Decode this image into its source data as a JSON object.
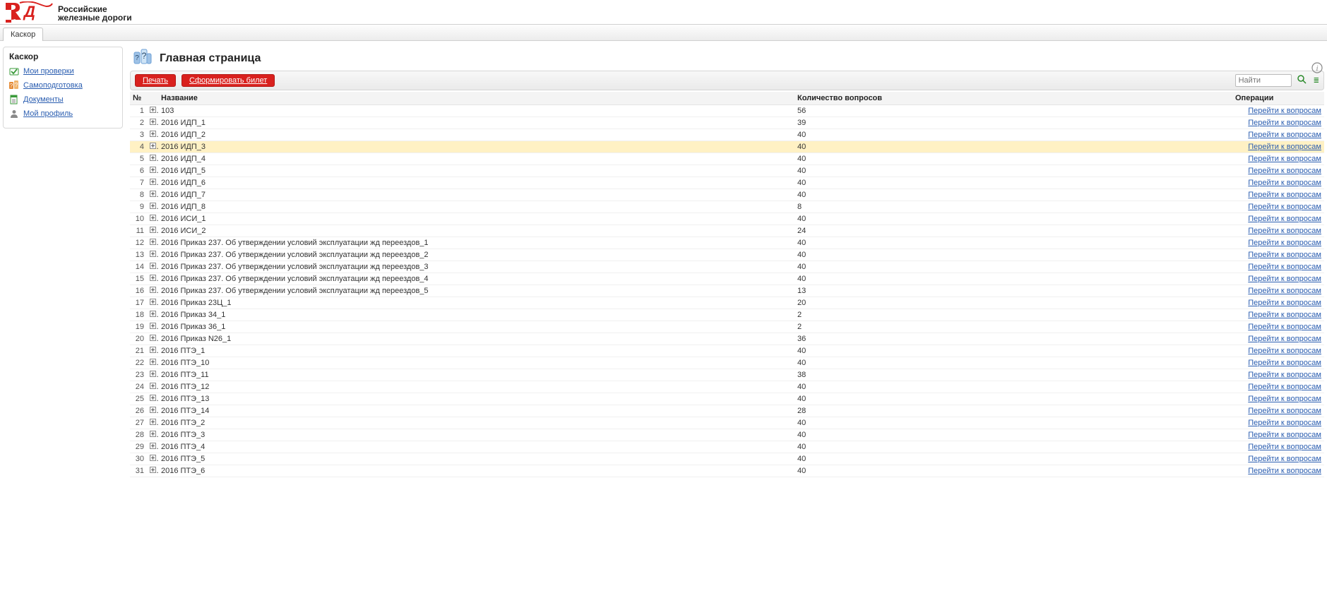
{
  "brand": {
    "line1": "Российские",
    "line2": "железные дороги"
  },
  "tabs": [
    {
      "label": "Каскор",
      "active": true
    }
  ],
  "sidebar": {
    "title": "Каскор",
    "items": [
      {
        "label": "Мои проверки",
        "id": "my-checks",
        "icon": "check"
      },
      {
        "label": "Самоподготовка",
        "id": "self-train",
        "icon": "question"
      },
      {
        "label": "Документы",
        "id": "documents",
        "icon": "doc"
      },
      {
        "label": "Мой профиль",
        "id": "profile",
        "icon": "user"
      }
    ]
  },
  "page": {
    "title": "Главная страница",
    "buttons": {
      "print": "Печать",
      "form_ticket": "Сформировать билет"
    },
    "search_placeholder": "Найти"
  },
  "table": {
    "headers": {
      "num": "№",
      "name": "Название",
      "count": "Количество вопросов",
      "ops": "Операции"
    },
    "op_link_label": "Перейти к вопросам",
    "highlight_index": 3,
    "rows": [
      {
        "n": 1,
        "name": "103",
        "count": 56
      },
      {
        "n": 2,
        "name": "2016 ИДП_1",
        "count": 39
      },
      {
        "n": 3,
        "name": "2016 ИДП_2",
        "count": 40
      },
      {
        "n": 4,
        "name": "2016 ИДП_3",
        "count": 40
      },
      {
        "n": 5,
        "name": "2016 ИДП_4",
        "count": 40
      },
      {
        "n": 6,
        "name": "2016 ИДП_5",
        "count": 40
      },
      {
        "n": 7,
        "name": "2016 ИДП_6",
        "count": 40
      },
      {
        "n": 8,
        "name": "2016 ИДП_7",
        "count": 40
      },
      {
        "n": 9,
        "name": "2016 ИДП_8",
        "count": 8
      },
      {
        "n": 10,
        "name": "2016 ИСИ_1",
        "count": 40
      },
      {
        "n": 11,
        "name": "2016 ИСИ_2",
        "count": 24
      },
      {
        "n": 12,
        "name": "2016 Приказ 237. Об утверждении условий эксплуатации жд переездов_1",
        "count": 40
      },
      {
        "n": 13,
        "name": "2016 Приказ 237. Об утверждении условий эксплуатации жд переездов_2",
        "count": 40
      },
      {
        "n": 14,
        "name": "2016 Приказ 237. Об утверждении условий эксплуатации жд переездов_3",
        "count": 40
      },
      {
        "n": 15,
        "name": "2016 Приказ 237. Об утверждении условий эксплуатации жд переездов_4",
        "count": 40
      },
      {
        "n": 16,
        "name": "2016 Приказ 237. Об утверждении условий эксплуатации жд переездов_5",
        "count": 13
      },
      {
        "n": 17,
        "name": "2016 Приказ 23Ц_1",
        "count": 20
      },
      {
        "n": 18,
        "name": "2016 Приказ 34_1",
        "count": 2
      },
      {
        "n": 19,
        "name": "2016 Приказ 36_1",
        "count": 2
      },
      {
        "n": 20,
        "name": "2016 Приказ N26_1",
        "count": 36
      },
      {
        "n": 21,
        "name": "2016 ПТЭ_1",
        "count": 40
      },
      {
        "n": 22,
        "name": "2016 ПТЭ_10",
        "count": 40
      },
      {
        "n": 23,
        "name": "2016 ПТЭ_11",
        "count": 38
      },
      {
        "n": 24,
        "name": "2016 ПТЭ_12",
        "count": 40
      },
      {
        "n": 25,
        "name": "2016 ПТЭ_13",
        "count": 40
      },
      {
        "n": 26,
        "name": "2016 ПТЭ_14",
        "count": 28
      },
      {
        "n": 27,
        "name": "2016 ПТЭ_2",
        "count": 40
      },
      {
        "n": 28,
        "name": "2016 ПТЭ_3",
        "count": 40
      },
      {
        "n": 29,
        "name": "2016 ПТЭ_4",
        "count": 40
      },
      {
        "n": 30,
        "name": "2016 ПТЭ_5",
        "count": 40
      },
      {
        "n": 31,
        "name": "2016 ПТЭ_6",
        "count": 40
      }
    ]
  }
}
